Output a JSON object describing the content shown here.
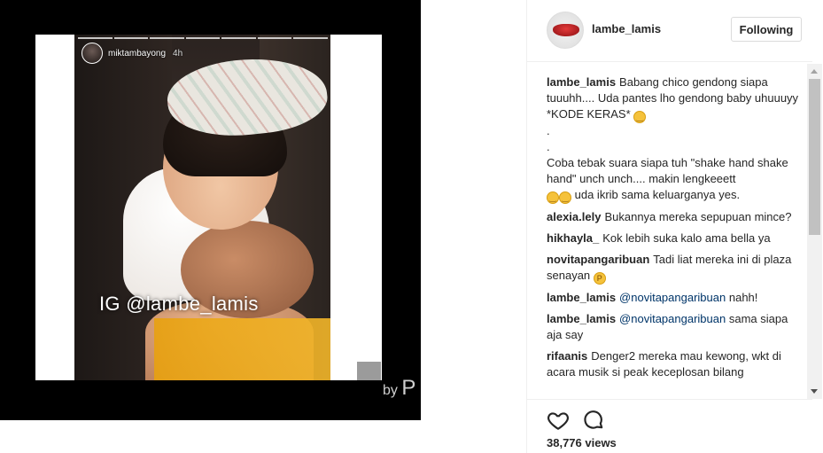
{
  "story": {
    "username": "miktambayong",
    "time": "4h",
    "watermark": "IG @lambe_lamis",
    "byline_prefix": "by",
    "byline_letter": "P"
  },
  "post": {
    "username": "lambe_lamis",
    "follow_label": "Following",
    "views": "38,776 views"
  },
  "comments": [
    {
      "user": "lambe_lamis",
      "text_lines": [
        "Babang chico gendong siapa tuuuhh.... Uda pantes lho gendong baby uhuuuyy *KODE KERAS*",
        ".",
        ".",
        "Coba tebak suara siapa tuh \"shake hand shake hand\" unch unch.... makin lengkeeett",
        "uda ikrib sama keluarganya yes."
      ]
    },
    {
      "user": "alexia.lely",
      "text": "Bukannya mereka sepupuan mince?"
    },
    {
      "user": "hikhayla_",
      "text": "Kok lebih suka kalo ama bella ya"
    },
    {
      "user": "novitapangaribuan",
      "text": "Tadi liat mereka ini di plaza senayan"
    },
    {
      "user": "lambe_lamis",
      "mention": "@novitapangaribuan",
      "text": "nahh!"
    },
    {
      "user": "lambe_lamis",
      "mention": "@novitapangaribuan",
      "text": "sama siapa aja say"
    },
    {
      "user": "rifaanis",
      "text": "Denger2 mereka mau kewong, wkt di acara musik si peak keceplosan bilang"
    }
  ],
  "icons": {
    "like": "heart-icon",
    "comment": "comment-icon"
  },
  "colors": {
    "mention": "#003569",
    "text": "#262626",
    "border": "#efefef"
  }
}
